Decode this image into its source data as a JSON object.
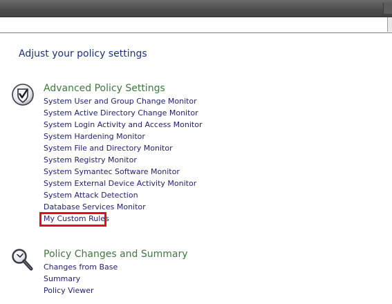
{
  "page": {
    "title": "Adjust your policy settings"
  },
  "sections": [
    {
      "heading": "Advanced Policy Settings",
      "icon": "policy-shield-icon",
      "links": [
        "System User and Group Change Monitor",
        "System Active Directory Change Monitor",
        "System Login Activity and Access Monitor",
        "System Hardening Monitor",
        "System File and Directory Monitor",
        "System Registry Monitor",
        "System Symantec Software Monitor",
        "System External Device Activity Monitor",
        "System Attack Detection",
        "Database Services Monitor",
        "My Custom Rules"
      ],
      "highlighted_link": "My Custom Rules"
    },
    {
      "heading": "Policy Changes and Summary",
      "icon": "magnifier-icon",
      "links": [
        "Changes from Base",
        "Summary",
        "Policy Viewer"
      ]
    }
  ],
  "colors": {
    "page_title": "#18317a",
    "section_heading": "#3d7a3d",
    "link": "#1d1f6e",
    "highlight": "#e01016",
    "titlebar": "#4e4e4e"
  }
}
